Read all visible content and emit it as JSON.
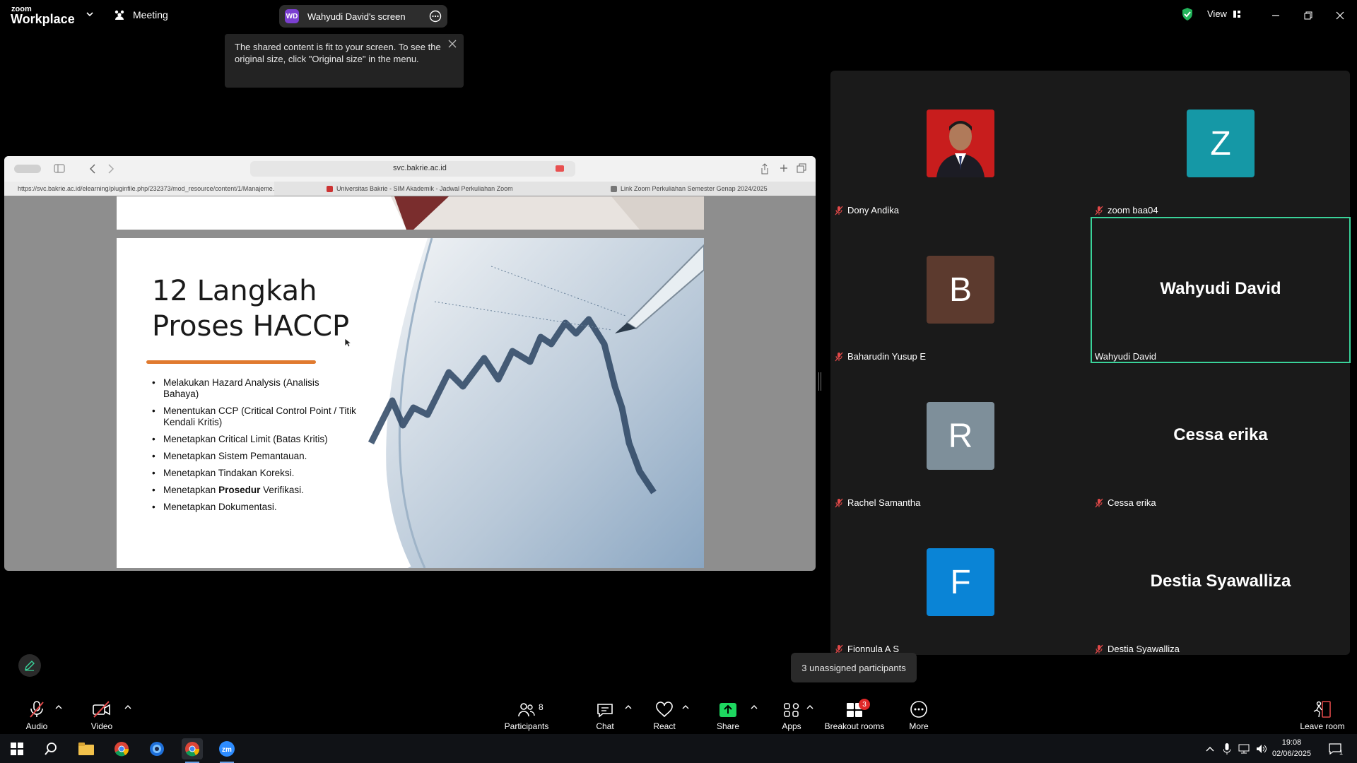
{
  "topbar": {
    "app_name_small": "zoom",
    "app_name": "Workplace",
    "meeting_label": "Meeting",
    "screen_owner_initials": "WD",
    "screen_label": "Wahyudi David's screen",
    "view_label": "View"
  },
  "tooltip": {
    "text": "The shared content is fit to your screen. To see the original size, click \"Original size\" in the menu."
  },
  "browser": {
    "url": "svc.bakrie.ac.id",
    "tabs": [
      {
        "label": "https://svc.bakrie.ac.id/elearning/pluginfile.php/232373/mod_resource/content/1/Manajeme..."
      },
      {
        "label": "Universitas Bakrie - SIM Akademik - Jadwal Perkuliahan Zoom"
      },
      {
        "label": "Link Zoom Perkuliahan Semester Genap 2024/2025"
      }
    ]
  },
  "slide": {
    "title_line1": "12 Langkah",
    "title_line2": "Proses HACCP",
    "bullets": [
      {
        "text": "Melakukan Hazard Analysis (Analisis Bahaya)"
      },
      {
        "text": "Menentukan CCP (Critical Control Point / Titik Kendali Kritis)"
      },
      {
        "text": "Menetapkan Critical Limit (Batas Kritis)"
      },
      {
        "text": "Menetapkan Sistem Pemantauan."
      },
      {
        "text": "Menetapkan Tindakan Koreksi."
      },
      {
        "pre": "Menetapkan ",
        "bold": "Prosedur",
        "post": " Verifikasi."
      },
      {
        "text": "Menetapkan Dokumentasi."
      }
    ]
  },
  "participants": [
    {
      "name": "Dony Andika",
      "avatar_type": "photo"
    },
    {
      "name": "zoom baa04",
      "initial": "Z",
      "color": "#1598a6"
    },
    {
      "name": "Baharudin Yusup E",
      "initial": "B",
      "color": "#5c3a2e"
    },
    {
      "name": "Wahyudi David",
      "display": "Wahyudi David",
      "active": true
    },
    {
      "name": "Rachel Samantha",
      "initial": "R",
      "color": "#7e8f9a"
    },
    {
      "name": "Cessa erika",
      "display": "Cessa erika"
    },
    {
      "name": "Fionnula A S",
      "initial": "F",
      "color": "#0a84d6"
    },
    {
      "name": "Destia Syawalliza",
      "display": "Destia Syawalliza"
    }
  ],
  "unassigned": "3 unassigned participants",
  "toolbar": {
    "audio": "Audio",
    "video": "Video",
    "participants": "Participants",
    "participants_count": "8",
    "chat": "Chat",
    "react": "React",
    "share": "Share",
    "apps": "Apps",
    "breakout": "Breakout rooms",
    "breakout_badge": "3",
    "more": "More",
    "leave": "Leave room"
  },
  "taskbar": {
    "time": "19:08",
    "date": "02/06/2025",
    "notif_count": "1"
  },
  "colors": {
    "accent_green": "#3ad39a",
    "share_green": "#1ed760",
    "mute_red": "#e04848",
    "slide_rule": "#e07a2f"
  }
}
